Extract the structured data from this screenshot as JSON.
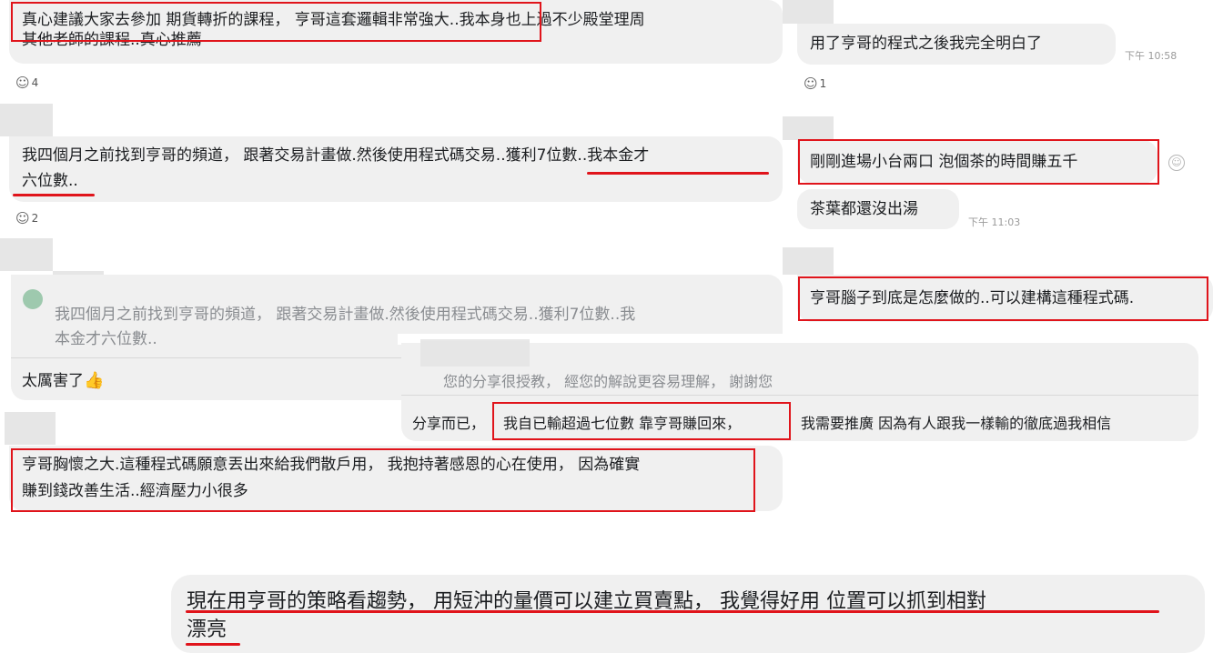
{
  "left_column": {
    "msg1": {
      "lines": [
        "真心建議大家去參加 期貨轉折的課程， 亨哥這套邏輯非常強大..我本身也上過不少殿堂理周",
        "其他老師的課程..真心推薦"
      ],
      "reaction_count": "4"
    },
    "msg2": {
      "lines": [
        "我四個月之前找到亨哥的頻道， 跟著交易計畫做.然後使用程式碼交易..獲利7位數..我本金才",
        "六位數.."
      ],
      "reaction_count": "2"
    },
    "msg3": {
      "quote_lines": [
        "我四個月之前找到亨哥的頻道， 跟著交易計畫做.然後使用程式碼交易..獲利7位數..我",
        "本金才六位數.."
      ],
      "reply_text": "太厲害了",
      "reply_emoji": "👍"
    },
    "msg4": {
      "lines": [
        "亨哥胸懷之大.這種程式碼願意丟出來給我們散戶用， 我抱持著感恩的心在使用， 因為確實",
        "賺到錢改善生活..經濟壓力小很多"
      ]
    }
  },
  "right_column": {
    "msg1": {
      "text": "用了亨哥的程式之後我完全明白了",
      "time": "下午 10:58",
      "reaction_count": "1"
    },
    "msg2": {
      "text": "剛剛進場小台兩口 泡個茶的時間賺五千"
    },
    "msg3": {
      "text": "茶葉都還沒出湯",
      "time": "下午 11:03"
    },
    "msg4": {
      "text": "亨哥腦子到底是怎麼做的..可以建構這種程式碼."
    }
  },
  "middle_popup": {
    "quote": "您的分享很授教， 經您的解說更容易理解， 謝謝您",
    "reply_part1": "分享而已，",
    "reply_part2": "我自已輸超過七位數 靠亨哥賺回來，",
    "reply_part3": "我需要推廣 因為有人跟我一樣輸的徹底過我相信"
  },
  "bottom": {
    "lines": [
      "現在用亨哥的策略看趨勢， 用短沖的量價可以建立買賣點， 我覺得好用 位置可以抓到相對",
      "漂亮"
    ]
  },
  "colors": {
    "highlight": "#e0141b",
    "bubble": "#f0f0f0",
    "quote_text": "#8a8d91"
  },
  "icons": {
    "reaction": "emoji-reaction-icon",
    "smiley": "smiley-icon",
    "thumbs_up": "thumbs-up-emoji"
  }
}
